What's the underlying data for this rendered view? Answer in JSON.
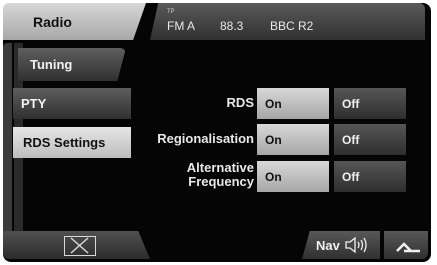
{
  "header": {
    "title": "Radio"
  },
  "status": {
    "tp": "TP",
    "band": "FM A",
    "frequency": "88.3",
    "station": "BBC R2"
  },
  "sidebar": {
    "items": [
      {
        "label": "Tuning"
      },
      {
        "label": "PTY"
      },
      {
        "label": "RDS Settings",
        "selected": true
      }
    ]
  },
  "settings": {
    "rds": {
      "label": "RDS",
      "on": "On",
      "off": "Off",
      "selected": "On"
    },
    "regionalisation": {
      "label": "Regionalisation",
      "on": "On",
      "off": "Off",
      "selected": "On"
    },
    "alternative_frequency": {
      "label_line1": "Alternative",
      "label_line2": "Frequency",
      "on": "On",
      "off": "Off",
      "selected": "On"
    }
  },
  "bottom": {
    "nav_label": "Nav"
  },
  "icons": {
    "close": "close-icon",
    "speaker": "speaker-icon",
    "back": "back-arrow-icon"
  },
  "colors": {
    "background": "#050505",
    "selected": "#c8c8c8",
    "button": "#3c3c3c",
    "text_light": "#f0f0f0"
  }
}
